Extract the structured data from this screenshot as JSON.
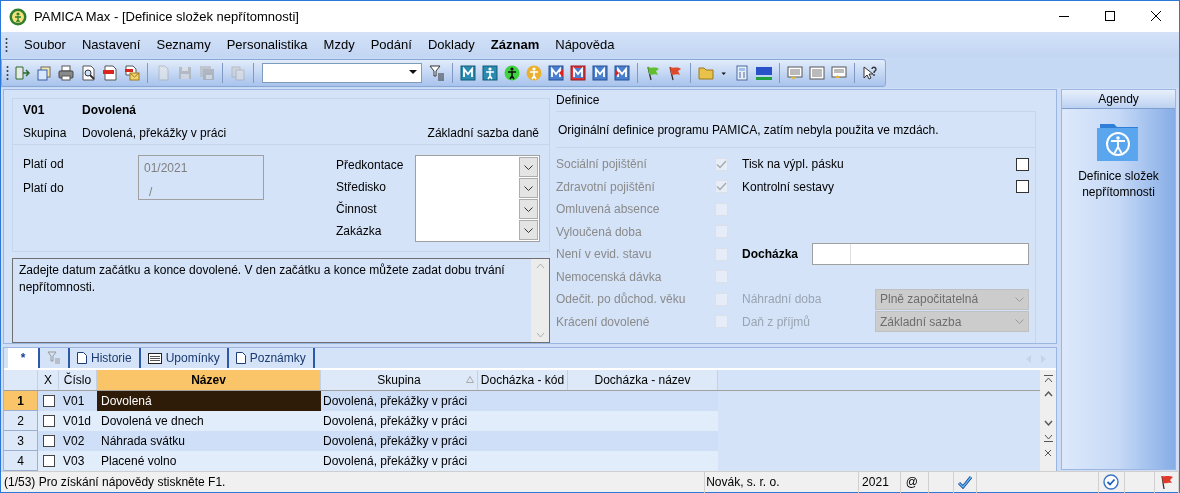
{
  "window": {
    "title": "PAMICA Max - [Definice složek nepřítomnosti]"
  },
  "menu": [
    {
      "label": "Soubor",
      "bold": false
    },
    {
      "label": "Nastavení",
      "bold": false
    },
    {
      "label": "Seznamy",
      "bold": false
    },
    {
      "label": "Personalistika",
      "bold": false
    },
    {
      "label": "Mzdy",
      "bold": false
    },
    {
      "label": "Podání",
      "bold": false
    },
    {
      "label": "Doklady",
      "bold": false
    },
    {
      "label": "Záznam",
      "bold": true
    },
    {
      "label": "Nápověda",
      "bold": false
    }
  ],
  "toolbar": [
    {
      "kind": "exit",
      "disabled": false
    },
    {
      "kind": "copy",
      "disabled": false
    },
    {
      "kind": "print",
      "disabled": false
    },
    {
      "kind": "preview",
      "disabled": false
    },
    {
      "kind": "pdf",
      "disabled": false
    },
    {
      "kind": "pdfmail",
      "disabled": false
    },
    {
      "kind": "separator"
    },
    {
      "kind": "new",
      "disabled": true
    },
    {
      "kind": "save",
      "disabled": true
    },
    {
      "kind": "saveall",
      "disabled": true
    },
    {
      "kind": "separator"
    },
    {
      "kind": "duplicate",
      "disabled": true
    },
    {
      "kind": "separator"
    },
    {
      "kind": "combo"
    },
    {
      "kind": "filter",
      "disabled": false
    },
    {
      "kind": "separator"
    },
    {
      "kind": "m",
      "disabled": false
    },
    {
      "kind": "person",
      "disabled": false
    },
    {
      "kind": "greenperson",
      "disabled": false
    },
    {
      "kind": "yellowperson",
      "disabled": false
    },
    {
      "kind": "mred",
      "disabled": false
    },
    {
      "kind": "mredfill",
      "disabled": false
    },
    {
      "kind": "mblue",
      "disabled": false
    },
    {
      "kind": "marrow",
      "disabled": false
    },
    {
      "kind": "separator"
    },
    {
      "kind": "greenflag",
      "disabled": false
    },
    {
      "kind": "redflag",
      "disabled": false
    },
    {
      "kind": "separator"
    },
    {
      "kind": "folder",
      "disabled": false
    },
    {
      "kind": "caret",
      "disabled": false
    },
    {
      "kind": "calculator",
      "disabled": false
    },
    {
      "kind": "iban",
      "disabled": false
    },
    {
      "kind": "separator"
    },
    {
      "kind": "listdown",
      "disabled": false
    },
    {
      "kind": "list",
      "disabled": false
    },
    {
      "kind": "listup",
      "disabled": false
    },
    {
      "kind": "separator"
    },
    {
      "kind": "help",
      "disabled": false
    }
  ],
  "record": {
    "code": "V01",
    "name": "Dovolená",
    "group_label": "Skupina",
    "group": "Dovolená, překážky v práci",
    "tax_rate": "Základní sazba daně"
  },
  "validity": {
    "from_label": "Platí od",
    "from": "01/2021",
    "to_label": "Platí do",
    "to": "/"
  },
  "accounting": [
    {
      "label": "Předkontace"
    },
    {
      "label": "Středisko"
    },
    {
      "label": "Činnost"
    },
    {
      "label": "Zakázka"
    }
  ],
  "description": "Zadejte datum začátku a konce dovolené. V den začátku a konce můžete zadat dobu trvání nepřítomnosti.",
  "definition": {
    "title": "Definice",
    "note": "Originální definice programu PAMICA, zatím nebyla použita ve mzdách.",
    "flags": [
      {
        "label": "Sociální pojištění",
        "checked": true,
        "disabled": true
      },
      {
        "label": "Zdravotní pojištění",
        "checked": true,
        "disabled": true
      },
      {
        "label": "Omluvená absence",
        "checked": false,
        "disabled": true
      },
      {
        "label": "Vyloučená doba",
        "checked": false,
        "disabled": true
      },
      {
        "label": "Není v evid. stavu",
        "checked": false,
        "disabled": true
      },
      {
        "label": "Nemocenská dávka",
        "checked": false,
        "disabled": true
      },
      {
        "label": "Odečit. po důchod. věku",
        "checked": false,
        "disabled": true
      },
      {
        "label": "Krácení dovolené",
        "checked": false,
        "disabled": true
      }
    ],
    "print_flags": [
      {
        "label": "Tisk na výpl. pásku",
        "checked": false
      },
      {
        "label": "Kontrolní sestavy",
        "checked": false
      }
    ],
    "attendance_label": "Docházka",
    "selects": [
      {
        "label": "Náhradní doba",
        "value": "Plně započitatelná",
        "disabled": true
      },
      {
        "label": "Daň z příjmů",
        "value": "Základní sazba",
        "disabled": true
      }
    ]
  },
  "agendas": {
    "title": "Agendy",
    "items": [
      {
        "label": "Definice složek nepřítomnosti"
      }
    ]
  },
  "grid": {
    "tabs": [
      {
        "kind": "text",
        "label": "*",
        "selected": true
      },
      {
        "kind": "filter",
        "selected": false
      },
      {
        "kind": "doc",
        "label": "Historie",
        "selected": false
      },
      {
        "kind": "list",
        "label": "Upomínky",
        "selected": false
      },
      {
        "kind": "doc",
        "label": "Poznámky",
        "selected": false
      }
    ],
    "columns": [
      {
        "label": "X",
        "highlighted": false,
        "sorted": false
      },
      {
        "label": "Číslo",
        "highlighted": false,
        "sorted": false
      },
      {
        "label": "Název",
        "highlighted": true,
        "sorted": false
      },
      {
        "label": "Skupina",
        "highlighted": false,
        "sorted": true
      },
      {
        "label": "Docházka - kód",
        "highlighted": false,
        "sorted": false
      },
      {
        "label": "Docházka - název",
        "highlighted": false,
        "sorted": false
      }
    ],
    "rows": [
      {
        "number": "1",
        "checked": false,
        "code": "V01",
        "name": "Dovolená",
        "group": "Dovolená, překážky v práci",
        "selected": true
      },
      {
        "number": "2",
        "checked": false,
        "code": "V01d",
        "name": "Dovolená ve dnech",
        "group": "Dovolená, překážky v práci",
        "selected": false
      },
      {
        "number": "3",
        "checked": false,
        "code": "V02",
        "name": "Náhrada svátku",
        "group": "Dovolená, překážky v práci",
        "selected": false
      },
      {
        "number": "4",
        "checked": false,
        "code": "V03",
        "name": "Placené volno",
        "group": "Dovolená, překážky v práci",
        "selected": false
      }
    ]
  },
  "status": {
    "hint": "(1/53) Pro získání nápovědy stiskněte F1.",
    "company": "Novák, s. r. o.",
    "year": "2021",
    "at": "@"
  }
}
